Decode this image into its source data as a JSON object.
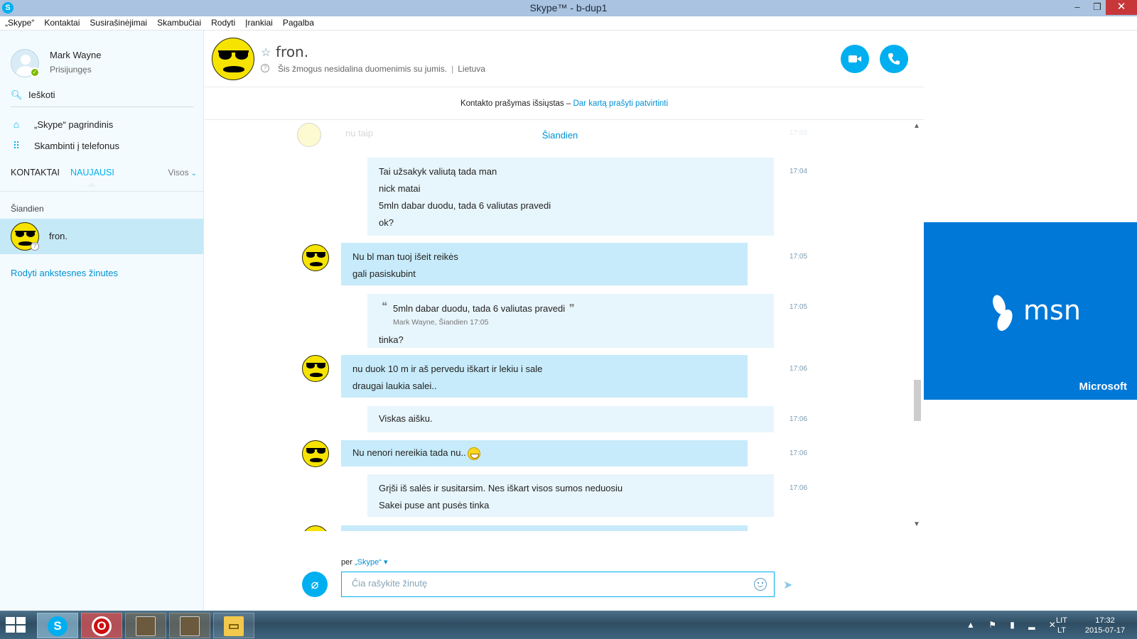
{
  "window": {
    "title": "Skype™ - b-dup1",
    "app_icon": "S",
    "minimize_glyph": "–",
    "maximize_glyph": "❐",
    "close_glyph": "✕"
  },
  "menu": [
    "„Skype“",
    "Kontaktai",
    "Susirašinėjimai",
    "Skambučiai",
    "Rodyti",
    "Įrankiai",
    "Pagalba"
  ],
  "sidebar": {
    "user_name": "Mark Wayne",
    "user_status": "Prisijungęs",
    "search_label": "Ieškoti",
    "nav_home": "„Skype“ pagrindinis",
    "nav_call_phones": "Skambinti į telefonus",
    "tab_contacts": "KONTAKTAI",
    "tab_recent": "NAUJAUSI",
    "filter_label": "Visos",
    "section_today": "Šiandien",
    "contact_name": "fron.",
    "older_messages_link": "Rodyti ankstesnes žinutes"
  },
  "conversation": {
    "contact_name": "fron.",
    "privacy_note": "Šis žmogus nesidalina duomenimis su jumis.",
    "location": "Lietuva",
    "info_separator": "|",
    "request_notice": "Kontakto prašymas išsiųstas –",
    "request_again_link": "Dar kartą prašyti patvirtinti",
    "day_separator": "Šiandien",
    "faded_preview": "nu taip",
    "faded_time": "17:03",
    "messages": [
      {
        "lines": [
          "Tai užsakyk valiutą tada man",
          "nick matai",
          "5mln dabar duodu, tada 6 valiutas pravedi",
          "ok?"
        ],
        "time": "17:04"
      },
      {
        "lines": [
          "Nu bl man tuoj išeit reikės",
          "gali pasiskubint"
        ],
        "time": "17:05"
      },
      {
        "quote_text": "5mln dabar duodu, tada 6 valiutas pravedi",
        "quote_open": "❝",
        "quote_close": "❞",
        "quote_meta": "Mark Wayne, Šiandien 17:05",
        "lines": [
          "tinka?"
        ],
        "time": "17:05"
      },
      {
        "lines": [
          "nu duok 10 m ir aš pervedu iškart ir lekiu i sale",
          "draugai laukia salei.."
        ],
        "time": "17:06"
      },
      {
        "lines": [
          "Viskas aišku."
        ],
        "time": "17:06"
      },
      {
        "lines": [
          "Nu nenori nereikia tada nu.."
        ],
        "time": "17:06"
      },
      {
        "lines": [
          "Grįši iš salės ir susitarsim. Nes iškart visos sumos neduosiu",
          "Sakei puse ant pusės tinka"
        ],
        "time": "17:06"
      }
    ]
  },
  "composer": {
    "via_label": "per",
    "via_service": "„Skype“",
    "via_chevron": "▾",
    "placeholder": "Čia rašykite žinutę",
    "attach_glyph": "⌀",
    "send_glyph": "➤"
  },
  "ad": {
    "logo_text": "msn",
    "brand": "Microsoft"
  },
  "taskbar": {
    "skype_glyph": "S",
    "opera_glyph": "O",
    "explorer_glyph": "▭",
    "tray_icons": "▲ ⚑ ▮ ▂ ✕",
    "lang_top": "LIT",
    "lang_bottom": "LT",
    "time": "17:32",
    "date": "2015-07-17"
  },
  "colors": {
    "accent": "#00aff0",
    "incoming_bubble": "#c7ebfa",
    "outgoing_bubble": "#e7f5fc",
    "selected_contact": "#c6e9f8",
    "ad_background": "#0078d7",
    "close_button": "#c7373a"
  },
  "icons": [
    "skype-logo-icon",
    "search-icon",
    "home-icon",
    "dialpad-icon",
    "chevron-down-icon",
    "star-icon",
    "help-icon",
    "video-call-icon",
    "phone-call-icon",
    "attach-icon",
    "emoticon-icon",
    "send-icon",
    "msn-butterfly-icon",
    "windows-start-icon"
  ]
}
